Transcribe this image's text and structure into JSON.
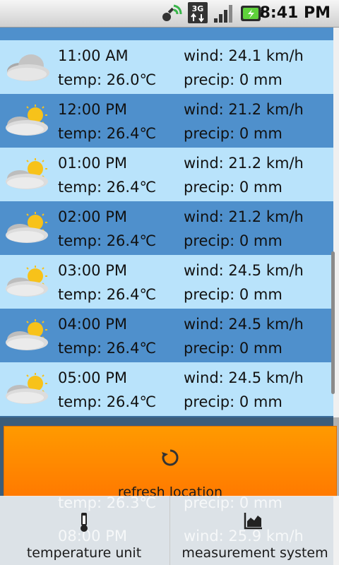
{
  "status": {
    "time": "8:41 PM",
    "network": "3G"
  },
  "forecast": [
    {
      "time": "11:00 AM",
      "temp": "temp: 26.0℃",
      "wind": "wind: 24.1 km/h",
      "precip": "precip: 0 mm",
      "icon": "cloud-icon"
    },
    {
      "time": "12:00 PM",
      "temp": "temp: 26.4℃",
      "wind": "wind: 21.2 km/h",
      "precip": "precip: 0 mm",
      "icon": "partly-cloudy-icon"
    },
    {
      "time": "01:00 PM",
      "temp": "temp: 26.4℃",
      "wind": "wind: 21.2 km/h",
      "precip": "precip: 0 mm",
      "icon": "partly-cloudy-icon"
    },
    {
      "time": "02:00 PM",
      "temp": "temp: 26.4℃",
      "wind": "wind: 21.2 km/h",
      "precip": "precip: 0 mm",
      "icon": "partly-cloudy-icon"
    },
    {
      "time": "03:00 PM",
      "temp": "temp: 26.4℃",
      "wind": "wind: 24.5 km/h",
      "precip": "precip: 0 mm",
      "icon": "partly-cloudy-icon"
    },
    {
      "time": "04:00 PM",
      "temp": "temp: 26.4℃",
      "wind": "wind: 24.5 km/h",
      "precip": "precip: 0 mm",
      "icon": "partly-cloudy-icon"
    },
    {
      "time": "05:00 PM",
      "temp": "temp: 26.4℃",
      "wind": "wind: 24.5 km/h",
      "precip": "precip: 0 mm",
      "icon": "partly-cloudy-icon"
    }
  ],
  "menu": {
    "refresh_label": "refresh location",
    "temperature_label": "temperature unit",
    "measurement_label": "measurement system"
  },
  "ghost_behind_menu": {
    "temp": "temp: 26.3℃",
    "precip": "precip: 0 mm",
    "time": "08:00 PM",
    "wind": "wind: 25.9 km/h"
  },
  "colors": {
    "row_light": "#b9e3fb",
    "row_dark": "#4f90cc",
    "menu_accent": "#ff8a00"
  }
}
